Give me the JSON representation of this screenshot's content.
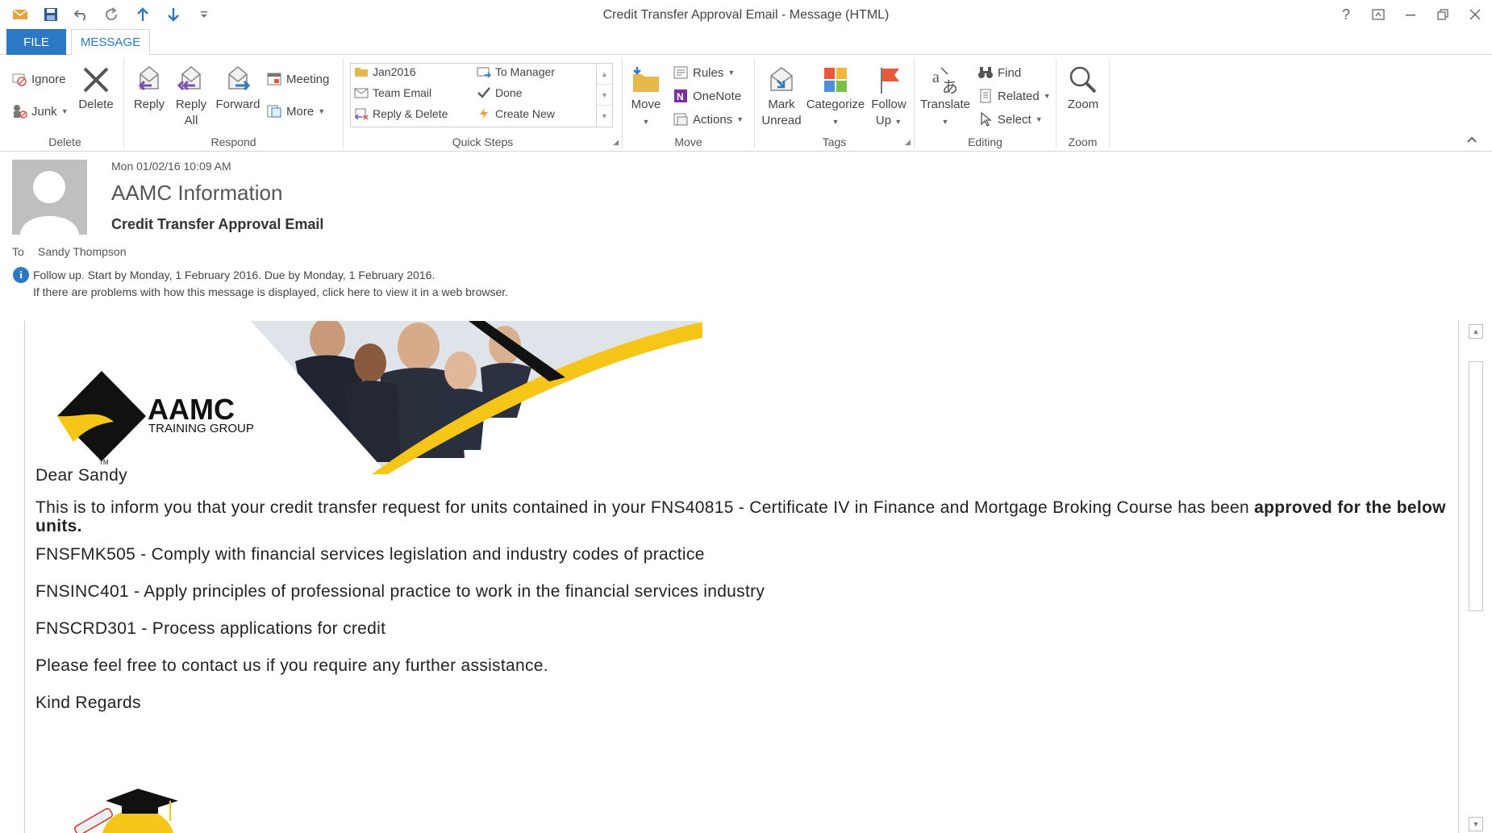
{
  "window": {
    "title": "Credit Transfer Approval Email - Message (HTML)",
    "help": "?",
    "controls": [
      "ribbon-display-options",
      "minimize",
      "restore",
      "close"
    ]
  },
  "tabs": {
    "file": "FILE",
    "message": "MESSAGE"
  },
  "ribbon": {
    "delete_group": {
      "label": "Delete",
      "ignore": "Ignore",
      "junk": "Junk",
      "delete": "Delete"
    },
    "respond_group": {
      "label": "Respond",
      "reply": "Reply",
      "reply_all_1": "Reply",
      "reply_all_2": "All",
      "forward": "Forward",
      "meeting": "Meeting",
      "more": "More"
    },
    "quicksteps_group": {
      "label": "Quick Steps",
      "items": [
        "Jan2016",
        "To Manager",
        "Team Email",
        "Done",
        "Reply & Delete",
        "Create New"
      ]
    },
    "move_group": {
      "label": "Move",
      "move": "Move",
      "rules": "Rules",
      "onenote": "OneNote",
      "actions": "Actions"
    },
    "tags_group": {
      "label": "Tags",
      "mark_unread_1": "Mark",
      "mark_unread_2": "Unread",
      "categorize": "Categorize",
      "follow_up_1": "Follow",
      "follow_up_2": "Up"
    },
    "editing_group": {
      "label": "Editing",
      "translate": "Translate",
      "find": "Find",
      "related": "Related",
      "select": "Select"
    },
    "zoom_group": {
      "label": "Zoom",
      "zoom": "Zoom"
    }
  },
  "header": {
    "date": "Mon 01/02/16 10:09 AM",
    "sender": "AAMC Information",
    "subject": "Credit Transfer Approval Email",
    "to_label": "To",
    "to": "Sandy Thompson",
    "info_line1": "Follow up.  Start by Monday, 1 February 2016.  Due by Monday, 1 February 2016.",
    "info_line2": "If there are problems with how this message is displayed, click here to view it in a web browser."
  },
  "banner": {
    "logo_main": "AAMC",
    "logo_sub": "TRAINING GROUP",
    "tm": "TM"
  },
  "email": {
    "greeting": "Dear Sandy",
    "intro": "This is to inform you that your credit transfer request for units contained in your FNS40815 - Certificate IV in Finance and Mortgage Broking Course has been ",
    "intro_bold": "approved for the below units.",
    "units": [
      "FNSFMK505 - Comply with financial services legislation and industry codes of practice",
      "FNSINC401 - Apply principles of professional practice to work in the financial services industry",
      "FNSCRD301 - Process applications for credit"
    ],
    "closing": "Please feel free to contact us if you require any further assistance.",
    "signoff": "Kind Regards"
  },
  "colors": {
    "accent": "#2b79c4",
    "brand_yellow": "#f5c518",
    "flag": "#e8583a"
  }
}
